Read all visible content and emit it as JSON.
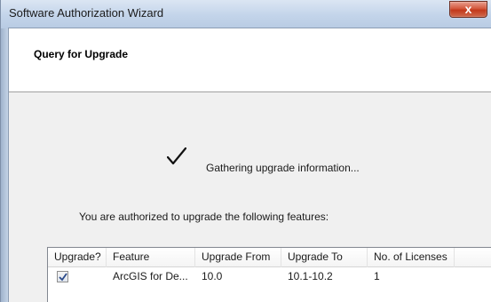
{
  "window": {
    "title": "Software Authorization Wizard",
    "close_label": "x"
  },
  "header": {
    "title": "Query for Upgrade"
  },
  "status": {
    "icon": "checkmark-icon",
    "message": "Gathering upgrade information..."
  },
  "intro": {
    "text": "You are authorized to upgrade the following features:"
  },
  "table": {
    "columns": [
      "Upgrade?",
      "Feature",
      "Upgrade From",
      "Upgrade To",
      "No. of Licenses"
    ],
    "rows": [
      {
        "checked": true,
        "feature": "ArcGIS for De...",
        "upgrade_from": "10.0",
        "upgrade_to": "10.1-10.2",
        "licenses": "1"
      }
    ]
  }
}
